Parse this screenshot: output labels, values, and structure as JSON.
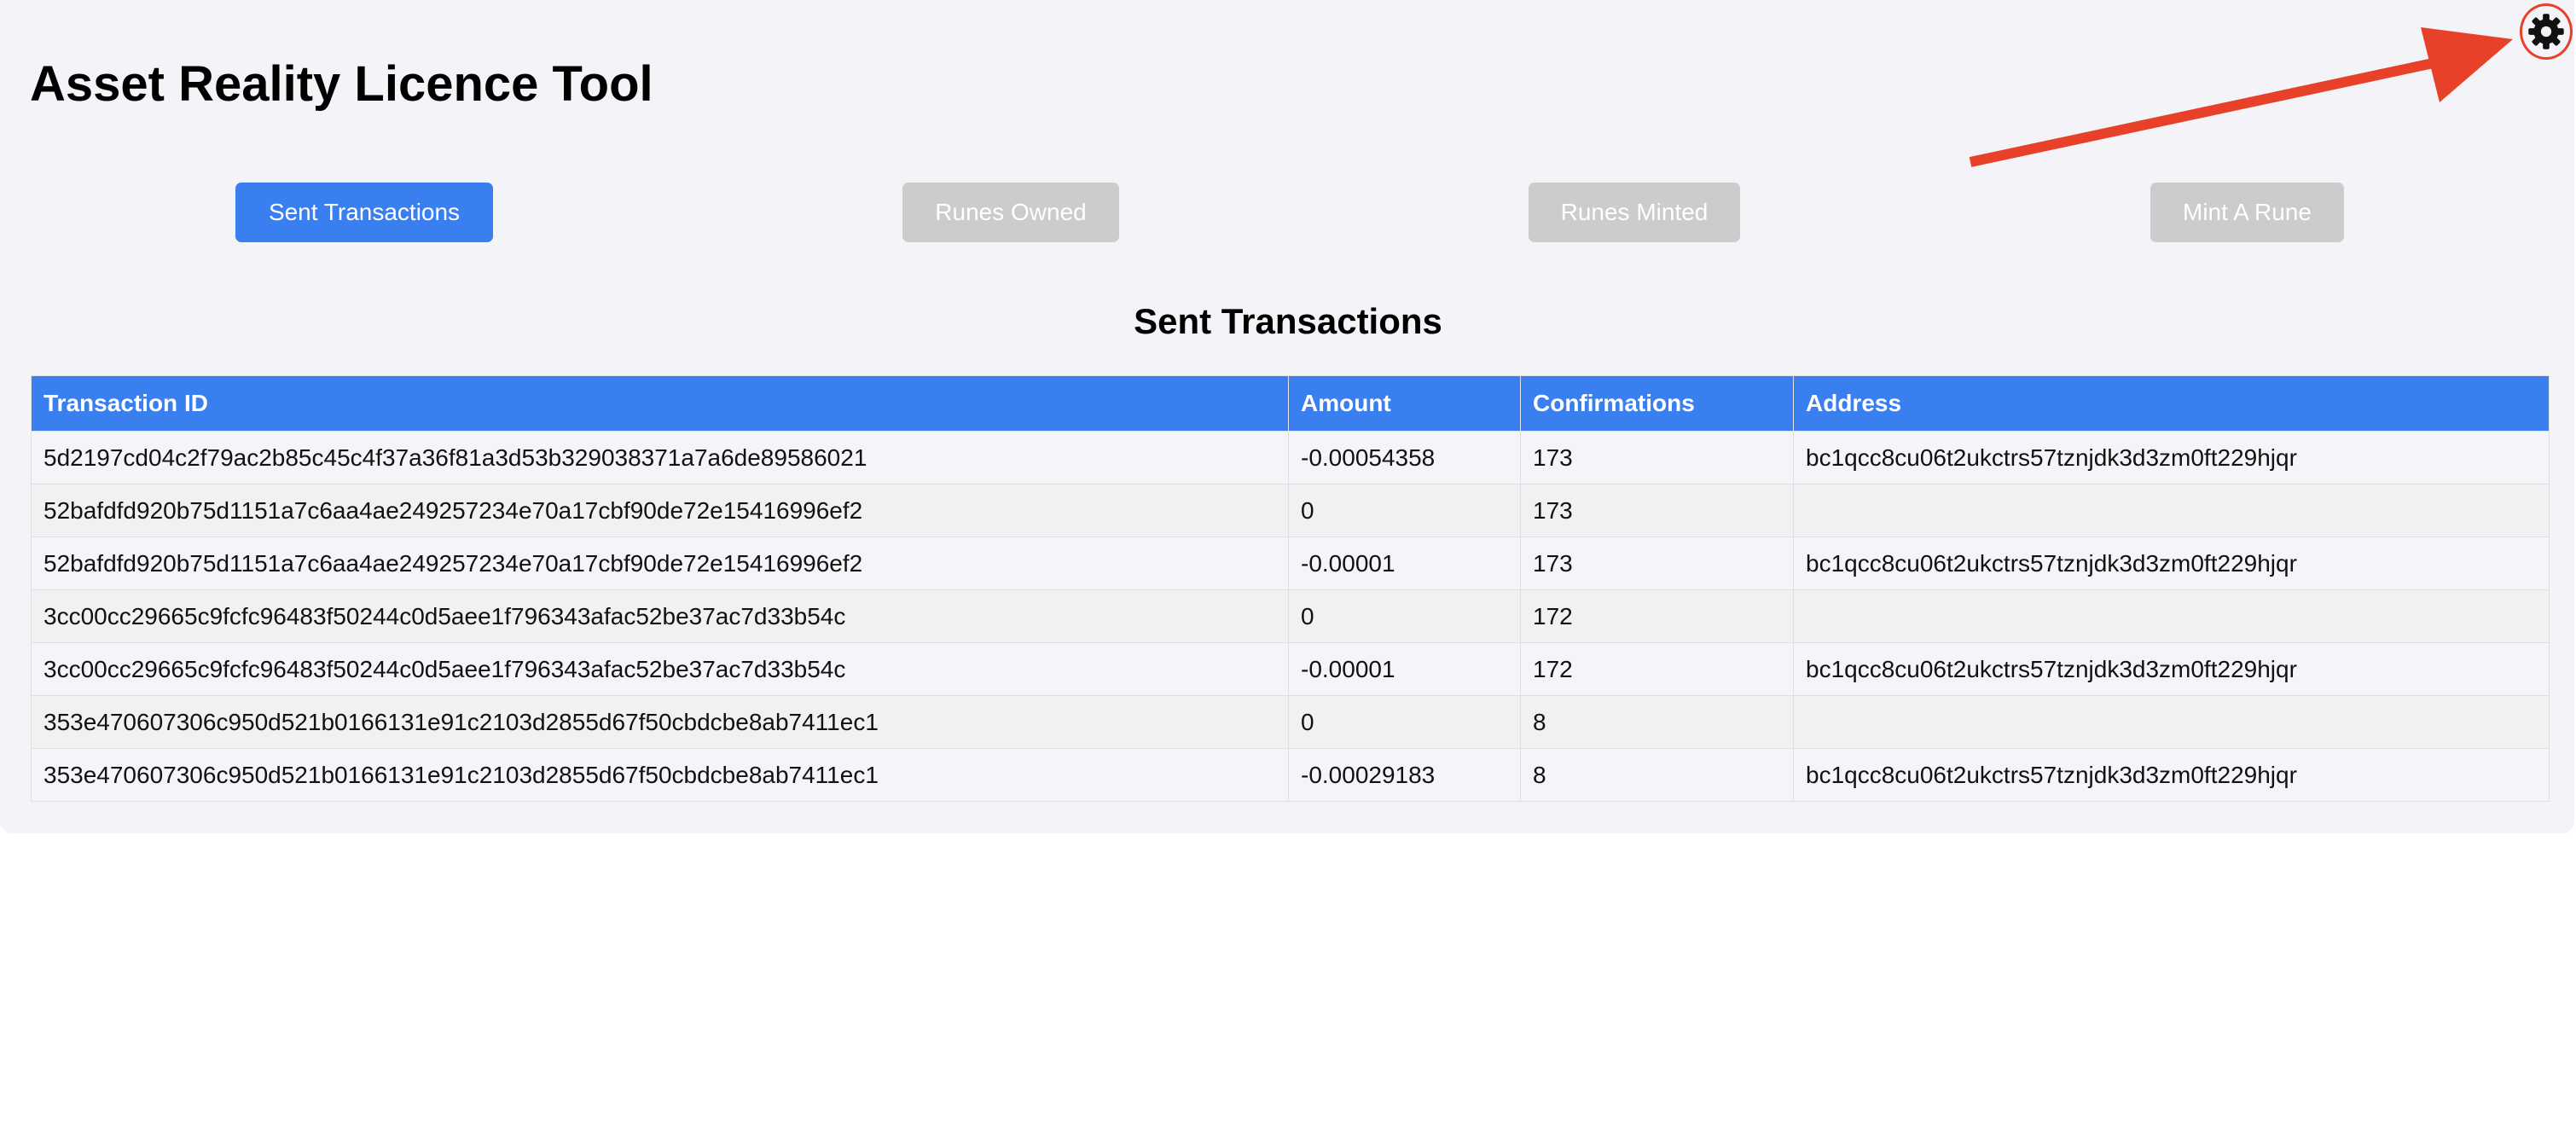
{
  "app": {
    "title": "Asset Reality Licence Tool"
  },
  "tabs": [
    {
      "label": "Sent Transactions",
      "active": true
    },
    {
      "label": "Runes Owned",
      "active": false
    },
    {
      "label": "Runes Minted",
      "active": false
    },
    {
      "label": "Mint A Rune",
      "active": false
    }
  ],
  "section": {
    "title": "Sent Transactions"
  },
  "table": {
    "headers": [
      "Transaction ID",
      "Amount",
      "Confirmations",
      "Address"
    ],
    "rows": [
      [
        "5d2197cd04c2f79ac2b85c45c4f37a36f81a3d53b329038371a7a6de89586021",
        "-0.00054358",
        "173",
        "bc1qcc8cu06t2ukctrs57tznjdk3d3zm0ft229hjqr"
      ],
      [
        "52bafdfd920b75d1151a7c6aa4ae249257234e70a17cbf90de72e15416996ef2",
        "0",
        "173",
        ""
      ],
      [
        "52bafdfd920b75d1151a7c6aa4ae249257234e70a17cbf90de72e15416996ef2",
        "-0.00001",
        "173",
        "bc1qcc8cu06t2ukctrs57tznjdk3d3zm0ft229hjqr"
      ],
      [
        "3cc00cc29665c9fcfc96483f50244c0d5aee1f796343afac52be37ac7d33b54c",
        "0",
        "172",
        ""
      ],
      [
        "3cc00cc29665c9fcfc96483f50244c0d5aee1f796343afac52be37ac7d33b54c",
        "-0.00001",
        "172",
        "bc1qcc8cu06t2ukctrs57tznjdk3d3zm0ft229hjqr"
      ],
      [
        "353e470607306c950d521b0166131e91c2103d2855d67f50cbdcbe8ab7411ec1",
        "0",
        "8",
        ""
      ],
      [
        "353e470607306c950d521b0166131e91c2103d2855d67f50cbdcbe8ab7411ec1",
        "-0.00029183",
        "8",
        "bc1qcc8cu06t2ukctrs57tznjdk3d3zm0ft229hjqr"
      ]
    ]
  },
  "settings": {
    "icon": "gear-icon"
  },
  "annotation": {
    "icon": "red-arrow-icon",
    "color": "#e8412a"
  },
  "colors": {
    "accent": "#3a7ff0",
    "inactive_tab": "#cccccc",
    "panel_bg": "#f4f4f8"
  }
}
